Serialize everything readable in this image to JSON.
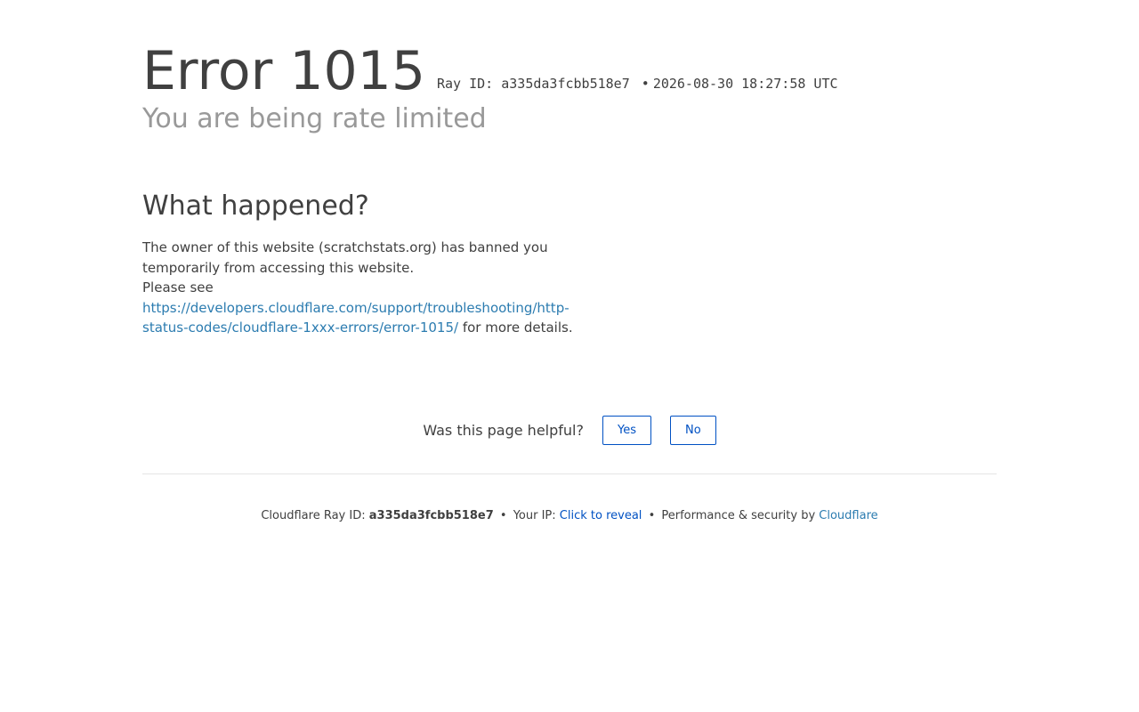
{
  "header": {
    "error_title": "Error 1015",
    "ray_label": "Ray ID: a335da3fcbb518e7",
    "separator": "•",
    "timestamp": "2026-08-30 18:27:58 UTC",
    "subtitle": "You are being rate limited"
  },
  "what_happened": {
    "heading": "What happened?",
    "line1": "The owner of this website (scratchstats.org) has banned you temporarily from accessing this website.",
    "please_see": "Please see",
    "link_text": "https://developers.cloudflare.com/support/troubleshooting/http-status-codes/cloudflare-1xxx-errors/error-1015/",
    "after_link": " for more details."
  },
  "feedback": {
    "question": "Was this page helpful?",
    "yes_label": "Yes",
    "no_label": "No"
  },
  "footer": {
    "ray_prefix": "Cloudflare Ray ID:",
    "ray_id": "a335da3fcbb518e7",
    "separator": "•",
    "ip_prefix": "Your IP:",
    "ip_link": "Click to reveal",
    "perf_text": "Performance & security by",
    "cloudflare_link": "Cloudflare"
  },
  "colors": {
    "text": "#404040",
    "muted": "#999999",
    "link": "#2c7cb0",
    "button": "#0051c3",
    "divider": "#e5e5e5"
  }
}
